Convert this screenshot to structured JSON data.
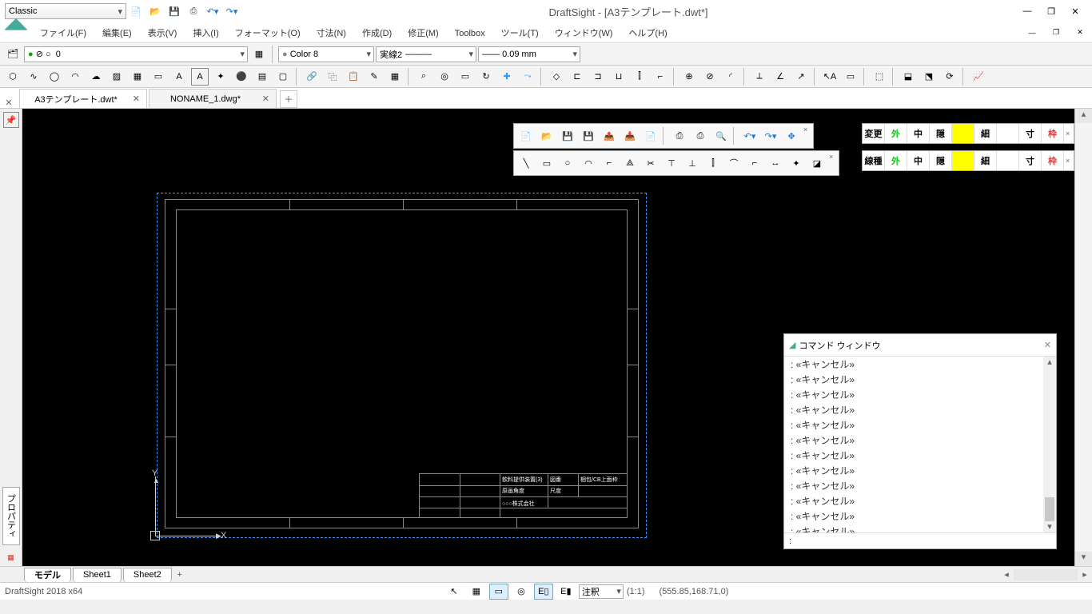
{
  "title": "DraftSight - [A3テンプレート.dwt*]",
  "workspace_dd": "Classic",
  "menus": [
    "ファイル(F)",
    "編集(E)",
    "表示(V)",
    "挿入(I)",
    "フォーマット(O)",
    "寸法(N)",
    "作成(D)",
    "修正(M)",
    "Toolbox",
    "ツール(T)",
    "ウィンドウ(W)",
    "ヘルプ(H)"
  ],
  "layer_dd": "0",
  "color_dd": "Color 8",
  "ltype_dd": "実線2",
  "lwt_dd": "0.09 mm",
  "doc_tabs": [
    {
      "label": "A3テンプレート.dwt*",
      "active": true
    },
    {
      "label": "NONAME_1.dwg*",
      "active": false
    }
  ],
  "side_label": "プロパティ",
  "jp_tb1": [
    "変更",
    "外",
    "中",
    "隠",
    "",
    "細",
    "",
    "寸",
    "枠"
  ],
  "jp_tb1_colors": [
    "#000",
    "#0c0",
    "#000",
    "#000",
    "#ff0",
    "#000",
    "#fff",
    "#000",
    "#e33"
  ],
  "jp_tb2": [
    "線種",
    "外",
    "中",
    "隠",
    "",
    "細",
    "",
    "寸",
    "枠"
  ],
  "cmdwin_title": "コマンド ウィンドウ",
  "cmd_lines": [
    ": «キャンセル»",
    ": «キャンセル»",
    ": «キャンセル»",
    ": «キャンセル»",
    ": «キャンセル»",
    ": «キャンセル»",
    ": «キャンセル»",
    ": «キャンセル»",
    ": «キャンセル»",
    ": «キャンセル»",
    ": «キャンセル»",
    ": «キャンセル»",
    ": «キャンセル»"
  ],
  "cmd_prompt": ":",
  "sheet_tabs": [
    "モデル",
    "Sheet1",
    "Sheet2"
  ],
  "sheet_active": 0,
  "title_block": {
    "r0c2": "飲料提供装置(3)",
    "r0c3": "図番",
    "r0c4": "梱包/CB上面枠",
    "r1c2": "原画角度",
    "r1c3": "尺度",
    "r2c2": "○○○株式会社"
  },
  "status": {
    "product": "DraftSight 2018 x64",
    "anno_dd": "注釈",
    "scale": "(1:1)",
    "coords": "(555.85,168.71,0)"
  }
}
